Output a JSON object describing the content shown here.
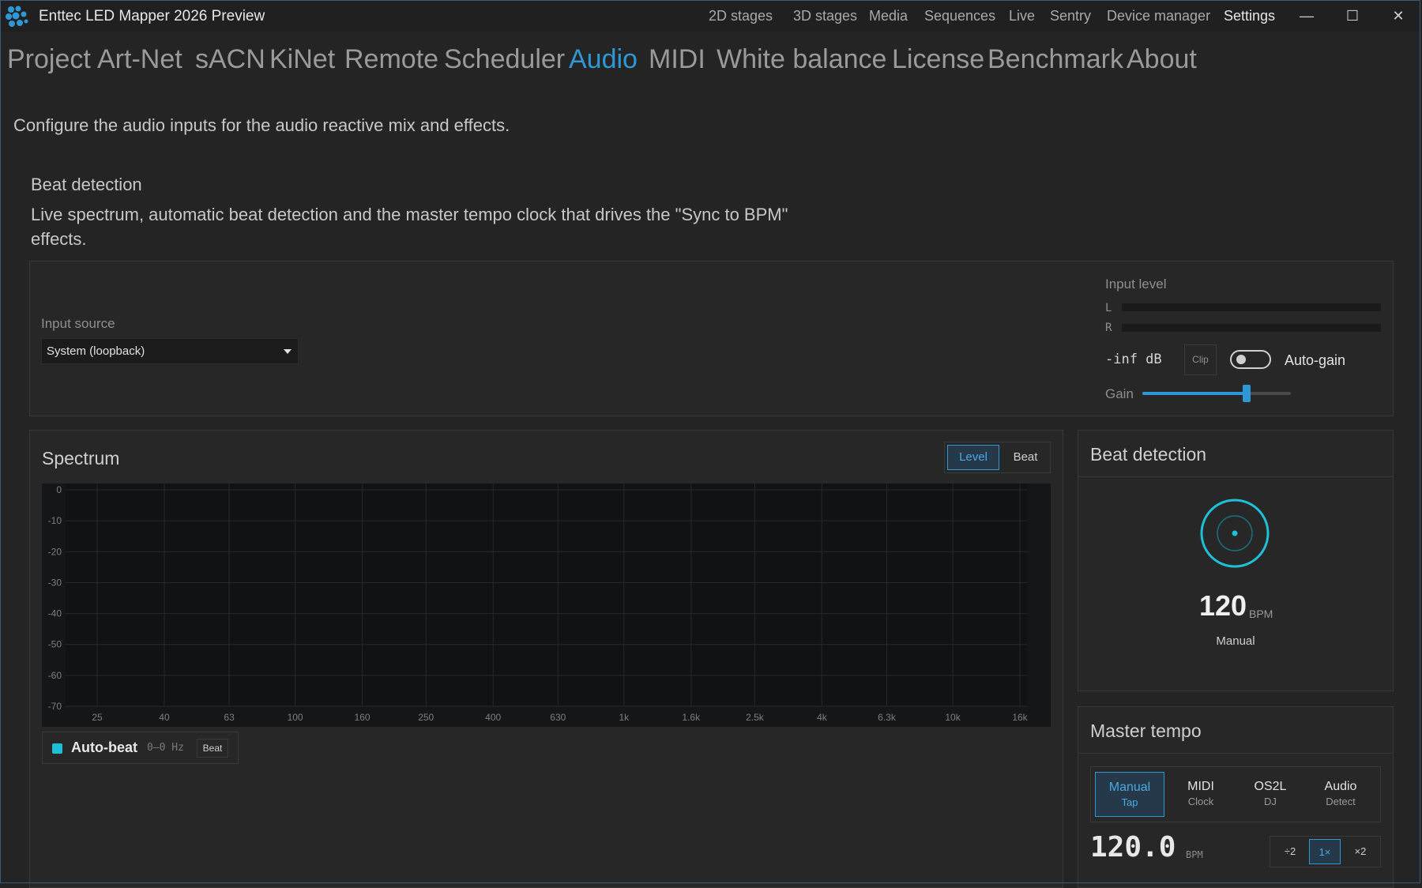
{
  "app": {
    "title": "Enttec LED Mapper 2026 Preview"
  },
  "top_nav": [
    "2D stages",
    "3D stages",
    "Media",
    "Sequences",
    "Live",
    "Sentry",
    "Device manager",
    "Settings"
  ],
  "top_nav_active": "Settings",
  "settings_tabs": [
    "Project",
    "Art-Net",
    "sACN",
    "KiNet",
    "Remote",
    "Scheduler",
    "Audio",
    "MIDI",
    "White balance",
    "License",
    "Benchmark",
    "About"
  ],
  "settings_tab_active": "Audio",
  "page": {
    "description": "Configure the audio inputs for the audio reactive mix and effects.",
    "section_title": "Beat detection",
    "section_desc": "Live spectrum, automatic beat detection and the master tempo clock that drives the \"Sync to BPM\" effects."
  },
  "input": {
    "source_label": "Input source",
    "source_value": "System (loopback)",
    "level_label": "Input level",
    "channel_l": "L",
    "channel_r": "R",
    "level_l": 0,
    "level_r": 0,
    "db_readout": "-inf dB",
    "clip_label": "Clip",
    "autogain_label": "Auto-gain",
    "autogain_on": false,
    "gain_label": "Gain",
    "gain_fraction": 0.7
  },
  "spectrum": {
    "title": "Spectrum",
    "mode_buttons": [
      "Level",
      "Beat"
    ],
    "mode_active": "Level",
    "legend_name": "Auto-beat",
    "legend_range": "0–0 Hz",
    "legend_button": "Beat",
    "legend_color": "#1dc0d6"
  },
  "chart_data": {
    "type": "line",
    "title": "Spectrum",
    "y_ticks": [
      "0",
      "-10",
      "-20",
      "-30",
      "-40",
      "-50",
      "-60",
      "-70"
    ],
    "x_ticks": [
      "25",
      "40",
      "63",
      "100",
      "160",
      "250",
      "400",
      "630",
      "1k",
      "1.6k",
      "2.5k",
      "4k",
      "6.3k",
      "10k",
      "16k"
    ],
    "ylim": [
      -70,
      0
    ],
    "x_scale": "log",
    "grid": true,
    "series": []
  },
  "beat_panel": {
    "title": "Beat detection",
    "bpm": "120",
    "bpm_unit": "BPM",
    "mode": "Manual",
    "accent": "#1dc0d6"
  },
  "master_tempo": {
    "title": "Master tempo",
    "sources": [
      {
        "main": "Manual",
        "sub": "Tap"
      },
      {
        "main": "MIDI",
        "sub": "Clock"
      },
      {
        "main": "OS2L",
        "sub": "DJ"
      },
      {
        "main": "Audio",
        "sub": "Detect"
      }
    ],
    "source_active": "Manual",
    "bpm_value": "120.0",
    "bpm_unit": "BPM",
    "multipliers": [
      "÷2",
      "1×",
      "×2"
    ],
    "multiplier_active": "1×"
  },
  "colors": {
    "accent": "#2e98d6",
    "background": "#242424",
    "plot_bg": "#141617"
  }
}
